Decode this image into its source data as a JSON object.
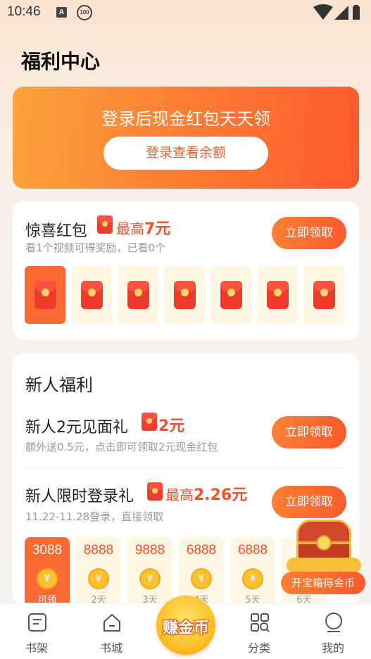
{
  "status_bar": {
    "time": "10:46",
    "icon_a": "A",
    "icon_badge": "100"
  },
  "page": {
    "title": "福利中心"
  },
  "login_banner": {
    "title": "登录后现金红包天天领",
    "button_label": "登录查看余额"
  },
  "surprise_red_packet": {
    "title": "惊喜红包",
    "reward_prefix": "最高",
    "reward_value": "7元",
    "subtitle": "看1个视频可得奖励，已看0个",
    "button_label": "立即领取",
    "envelope_count": 7,
    "active_index": 0
  },
  "new_user": {
    "section_title": "新人福利",
    "gift": {
      "title": "新人2元见面礼",
      "reward_value": "2元",
      "subtitle": "额外送0.5元，点击即可领取2元现金红包",
      "button_label": "立即领取"
    },
    "login_gift": {
      "title": "新人限时登录礼",
      "reward_prefix": "最高",
      "reward_value": "2.26元",
      "subtitle": "11.22-11.28登录，直接领取",
      "button_label": "立即领取"
    },
    "coin_days": [
      {
        "amount": "3088",
        "label": "可领",
        "active": true
      },
      {
        "amount": "8888",
        "label": "2天",
        "active": false
      },
      {
        "amount": "9888",
        "label": "3天",
        "active": false
      },
      {
        "amount": "6888",
        "label": "4天",
        "active": false
      },
      {
        "amount": "6888",
        "label": "5天",
        "active": false
      },
      {
        "amount": "",
        "label": "6天",
        "active": false
      }
    ]
  },
  "treasure_chest": {
    "label": "开宝箱得金币"
  },
  "bottom_nav": {
    "items": [
      {
        "label": "书架",
        "icon": "bookshelf-icon"
      },
      {
        "label": "书城",
        "icon": "bookstore-icon"
      },
      {
        "label": "赚金币",
        "icon": "earn-coins-icon"
      },
      {
        "label": "分类",
        "icon": "category-icon"
      },
      {
        "label": "我的",
        "icon": "profile-icon"
      }
    ]
  },
  "colors": {
    "accent": "#fd6a33",
    "accent_text": "#f3502b",
    "coin_gold": "#f9c22e"
  }
}
